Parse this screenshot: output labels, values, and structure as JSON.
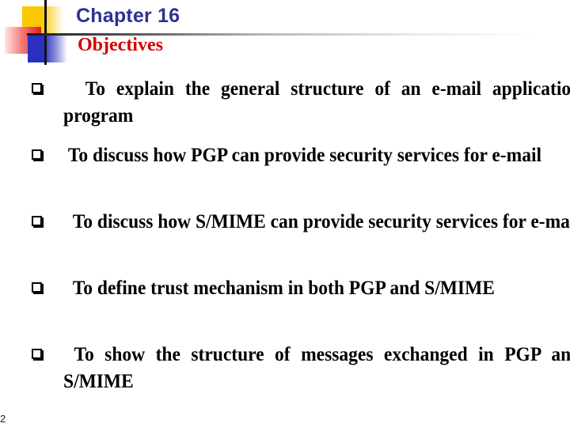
{
  "header": {
    "title": "Chapter 16",
    "subtitle": "Objectives",
    "title_color": "#2e3192",
    "subtitle_color": "#d40000"
  },
  "logo": {
    "icon": "decorative-color-squares-icon",
    "colors": [
      "#f9c800",
      "#e31b1b",
      "#2a2fc0"
    ]
  },
  "objectives": [
    {
      "bullet_icon": "hollow-square-bullet-icon",
      "text": "  To explain the general structure of an e-mail application program"
    },
    {
      "bullet_icon": "hollow-square-bullet-icon",
      "text": " To discuss how PGP can provide security services for e-mail"
    },
    {
      "bullet_icon": "hollow-square-bullet-icon",
      "text": "  To discuss how S/MIME can provide security services for e-mail"
    },
    {
      "bullet_icon": "hollow-square-bullet-icon",
      "text": "  To define trust mechanism in both PGP and S/MIME"
    },
    {
      "bullet_icon": "hollow-square-bullet-icon",
      "text": " To show the structure of messages exchanged in PGP and S/MIME"
    }
  ],
  "footer": {
    "page_number": "2"
  }
}
